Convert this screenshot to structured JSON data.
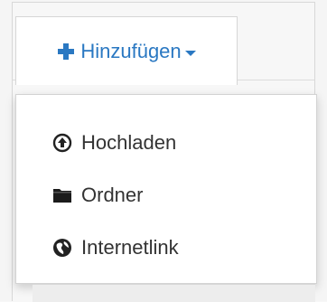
{
  "toolbar": {
    "add_label": "Hinzufügen",
    "add_icon": "plus-icon",
    "caret_icon": "caret-down-icon"
  },
  "dropdown": {
    "items": [
      {
        "label": "Hochladen",
        "icon": "upload-circle-icon"
      },
      {
        "label": "Ordner",
        "icon": "folder-icon"
      },
      {
        "label": "Internetlink",
        "icon": "globe-icon"
      }
    ]
  },
  "colors": {
    "accent": "#2a78c2",
    "text": "#333333"
  }
}
